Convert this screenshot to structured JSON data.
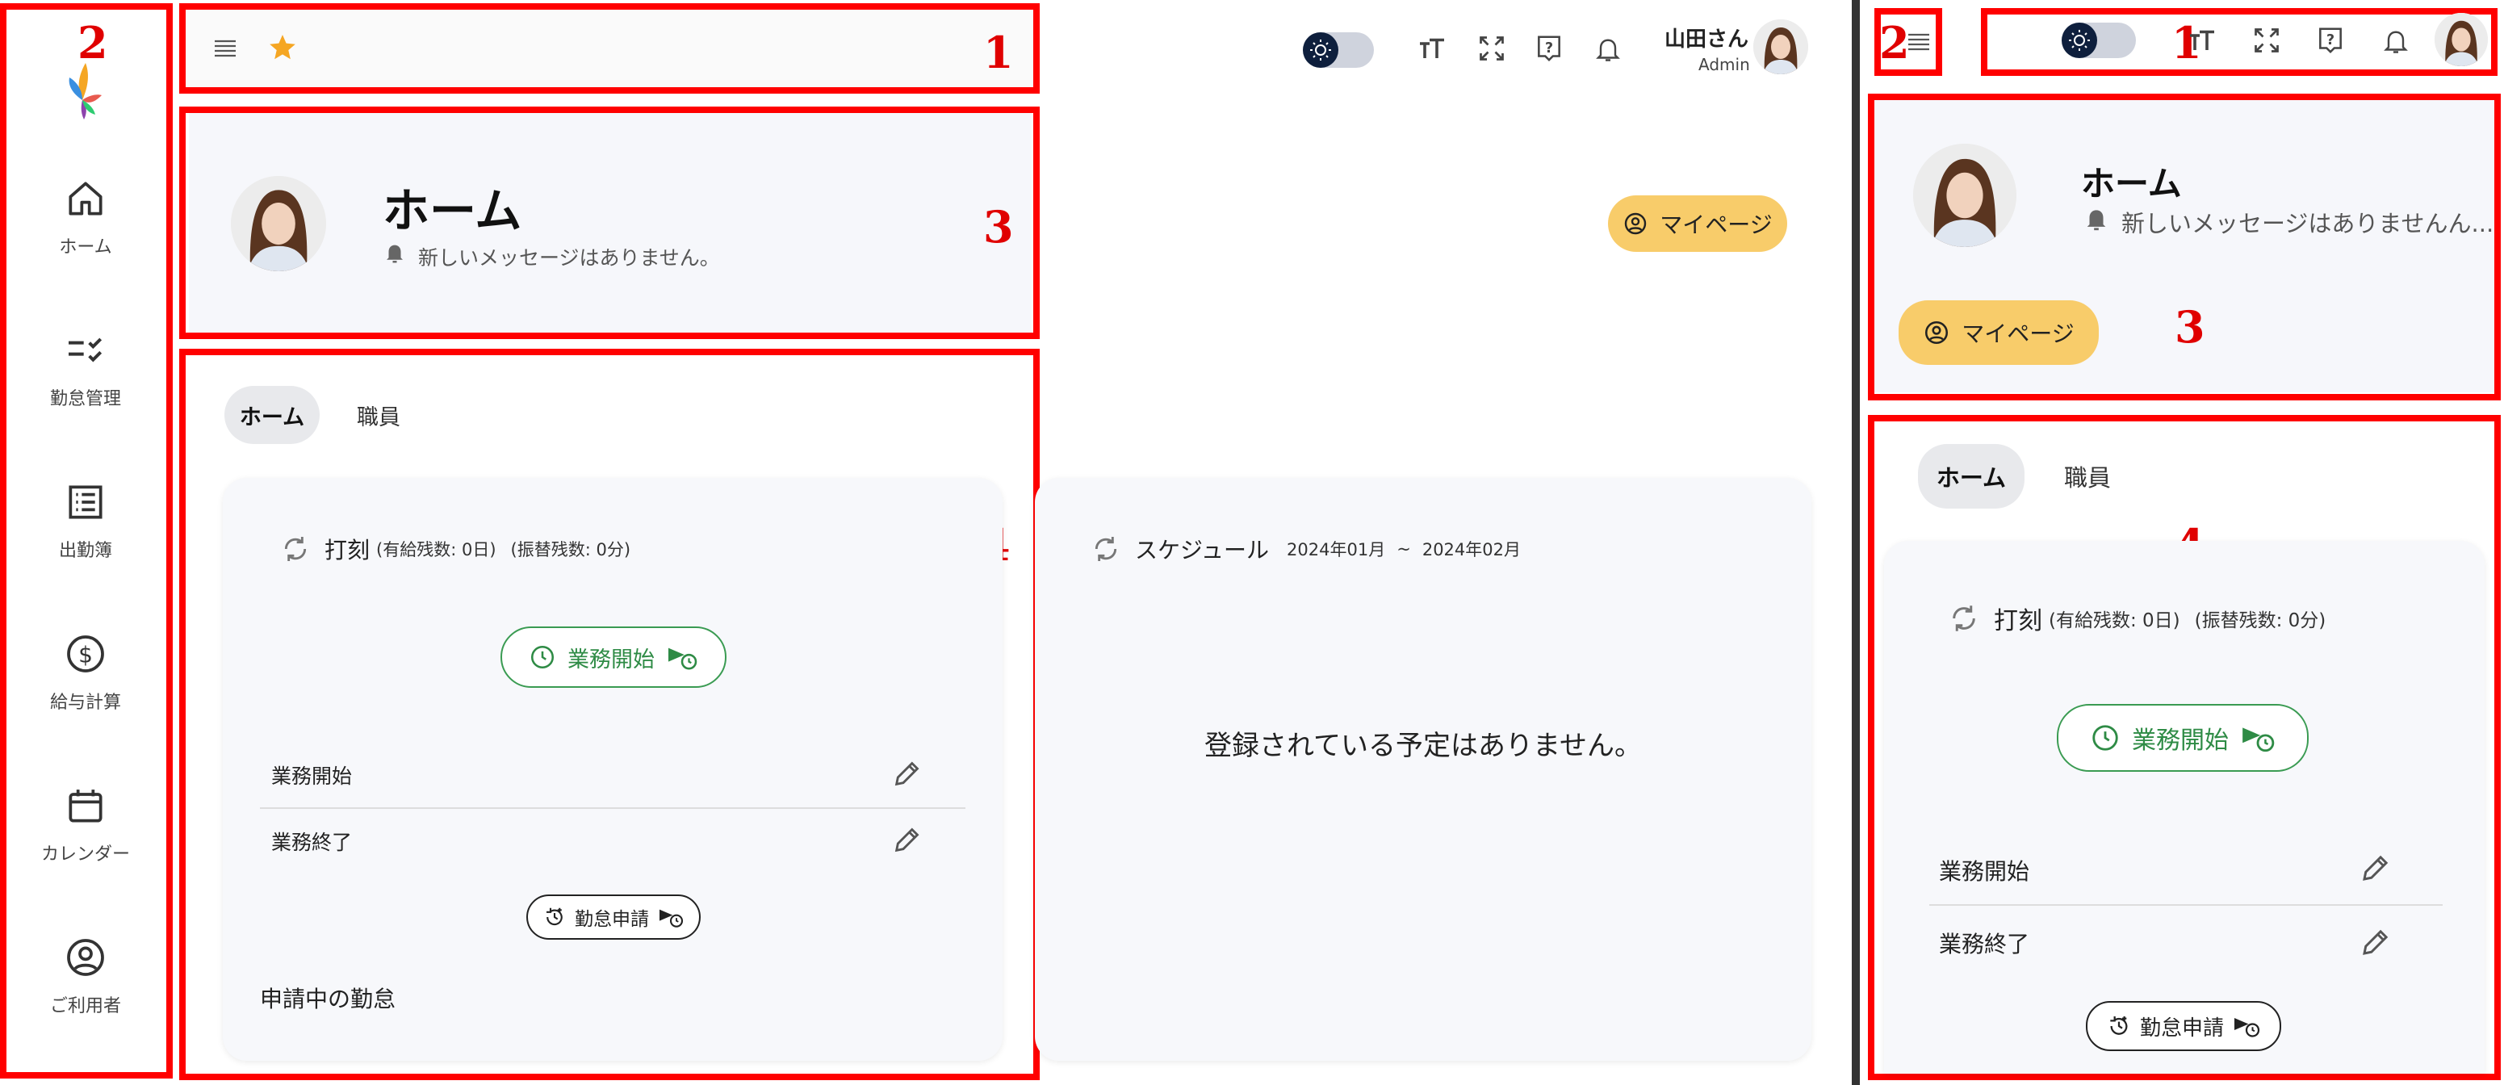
{
  "annotations": [
    "1",
    "2",
    "3",
    "4"
  ],
  "user": {
    "name": "山田さん",
    "role": "Admin"
  },
  "sidebar": {
    "items": [
      {
        "label": "ホーム",
        "icon": "home-icon"
      },
      {
        "label": "勤怠管理",
        "icon": "checklist-icon"
      },
      {
        "label": "出勤簿",
        "icon": "list-icon"
      },
      {
        "label": "給与計算",
        "icon": "dollar-icon"
      },
      {
        "label": "カレンダー",
        "icon": "calendar-icon"
      },
      {
        "label": "ご利用者",
        "icon": "account-circle-icon"
      }
    ]
  },
  "header": {
    "title": "ホーム",
    "message": "新しいメッセージはありません。",
    "message_truncated": "新しいメッセージはありませんん...",
    "mypage_label": "マイページ"
  },
  "tabs": [
    {
      "label": "ホーム",
      "active": true
    },
    {
      "label": "職員",
      "active": false
    }
  ],
  "punch_card": {
    "title": "打刻",
    "paid_leave": "(有給残数: 0日)",
    "substitute": "(振替残数: 0分)",
    "start_button": "業務開始",
    "rows": [
      "業務開始",
      "業務終了"
    ],
    "request_button": "勤怠申請",
    "pending_label": "申請中の勤怠"
  },
  "schedule_card": {
    "title": "スケジュール",
    "range_start": "2024年01月",
    "range_sep": "~",
    "range_end": "2024年02月",
    "empty": "登録されている予定はありません。"
  },
  "colors": {
    "annotation": "#ff0000",
    "accent": "#f8cc6a",
    "star": "#f5a623",
    "green": "#2e8b45",
    "toggle_knob": "#0e1f3d"
  }
}
